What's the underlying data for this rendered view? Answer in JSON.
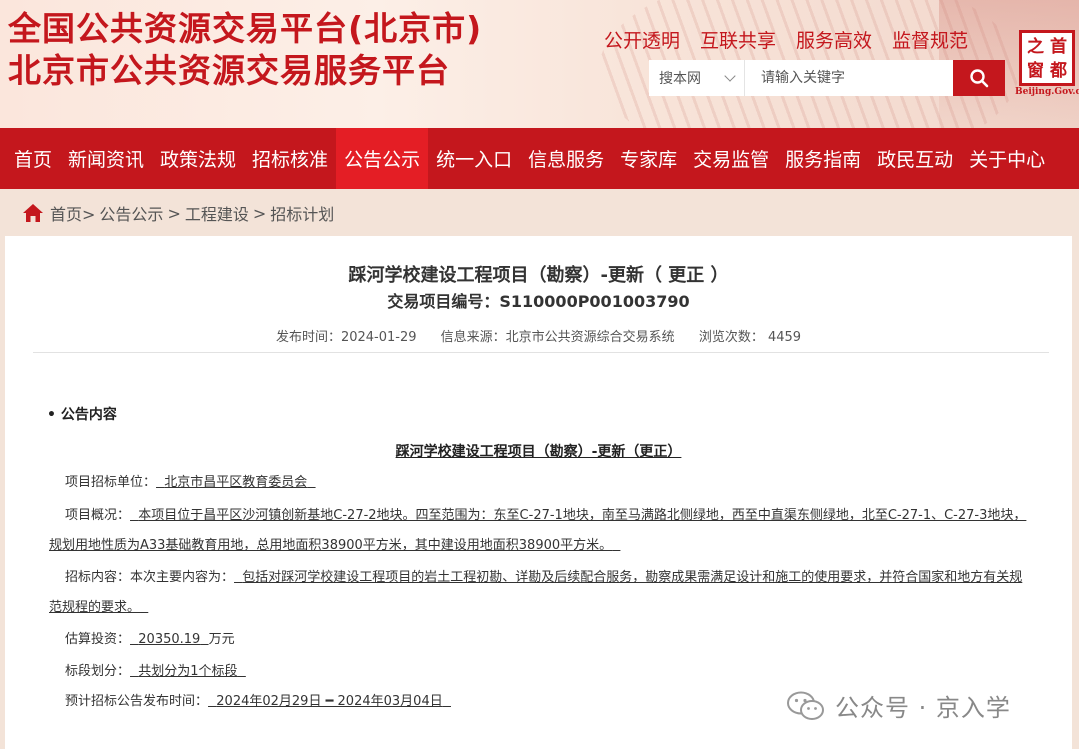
{
  "header": {
    "title_line1": "全国公共资源交易平台(北京市)",
    "title_line2": "北京市公共资源交易服务平台",
    "slogans": [
      "公开透明",
      "互联共享",
      "服务高效",
      "监督规范"
    ],
    "search": {
      "scope": "搜本网",
      "placeholder": "请输入关键字"
    },
    "logo": {
      "chars": [
        "首",
        "都",
        "之",
        "窗"
      ],
      "subtitle": "Beijing.Gov.cn"
    }
  },
  "nav": {
    "items": [
      "首页",
      "新闻资讯",
      "政策法规",
      "招标核准",
      "公告公示",
      "统一入口",
      "信息服务",
      "专家库",
      "交易监管",
      "服务指南",
      "政民互动",
      "关于中心"
    ],
    "active_index": 4
  },
  "breadcrumb": {
    "items": [
      "首页>",
      "公告公示",
      ">",
      "工程建设",
      ">",
      "招标计划"
    ]
  },
  "document": {
    "title": "踩河学校建设工程项目（勘察）-更新（ 更正 ）",
    "code": "交易项目编号：S110000P001003790",
    "meta": {
      "publish_time": "发布时间：2024-01-29",
      "source": "信息来源：北京市公共资源综合交易系统",
      "views": "浏览次数：  4459"
    },
    "section_label": "• 公告内容",
    "announce_title": "踩河学校建设工程项目（勘察）-更新（更正）",
    "fields": {
      "unit_label": "项目招标单位：",
      "unit_value": "北京市昌平区教育委员会",
      "overview_label": "项目概况：",
      "overview_value": "本项目位于昌平区沙河镇创新基地C-27-2地块。四至范围为：东至C-27-1地块，南至马满路北侧绿地，西至中直渠东侧绿地，北至C-27-1、C-27-3地块，规划用地性质为A33基础教育用地，总用地面积38900平方米，其中建设用地面积38900平方米。",
      "content_label": "招标内容：本次主要内容为：",
      "content_value": "包括对踩河学校建设工程项目的岩土工程初勘、详勘及后续配合服务，勘察成果需满足设计和施工的使用要求，并符合国家和地方有关规范规程的要求。",
      "invest_label": "估算投资：",
      "invest_value": "20350.19",
      "invest_unit": "万元",
      "section_div_label": "标段划分：",
      "section_div_value": "共划分为1个标段",
      "publish_plan_label": "预计招标公告发布时间：",
      "publish_plan_value": "2024年02月29日 ━ 2024年03月04日"
    }
  },
  "watermark": {
    "text": "公众号 · 京入学"
  },
  "colors": {
    "brand_red": "#c4171d",
    "nav_active": "#e41e25",
    "page_bg": "#f3e3d8"
  }
}
